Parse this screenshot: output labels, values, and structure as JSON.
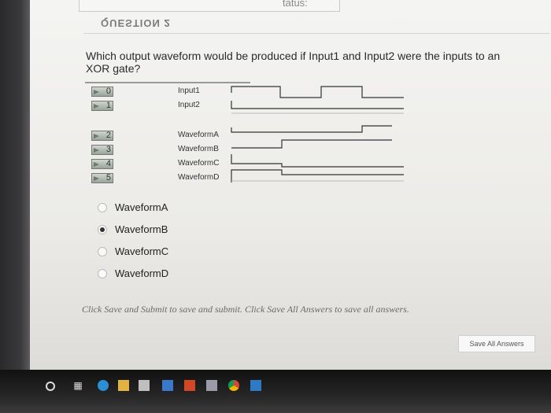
{
  "page": {
    "status_partial": "tatus:",
    "question_header": "QUESTION 2",
    "question_text": "Which output waveform would be produced if Input1 and Input2 were the inputs to an XOR gate?"
  },
  "figure": {
    "inputs": [
      {
        "probe": "0",
        "label": "Input1"
      },
      {
        "probe": "1",
        "label": "Input2"
      }
    ],
    "outputs": [
      {
        "probe": "2",
        "label": "WaveformA"
      },
      {
        "probe": "3",
        "label": "WaveformB"
      },
      {
        "probe": "4",
        "label": "WaveformC"
      },
      {
        "probe": "5",
        "label": "WaveformD"
      }
    ]
  },
  "answers": {
    "options": [
      {
        "label": "WaveformA",
        "checked": false
      },
      {
        "label": "WaveformB",
        "checked": true
      },
      {
        "label": "WaveformC",
        "checked": false
      },
      {
        "label": "WaveformD",
        "checked": false
      }
    ]
  },
  "footer": {
    "note": "Click Save and Submit to save and submit. Click Save All Answers to save all answers.",
    "save_all_label": "Save All Answers"
  },
  "taskbar": {
    "icons": [
      "start-icon",
      "task-view-icon",
      "edge-icon",
      "file-explorer-icon",
      "store-icon",
      "mail-icon",
      "office-icon",
      "app-icon",
      "chrome-icon",
      "photos-icon"
    ]
  }
}
